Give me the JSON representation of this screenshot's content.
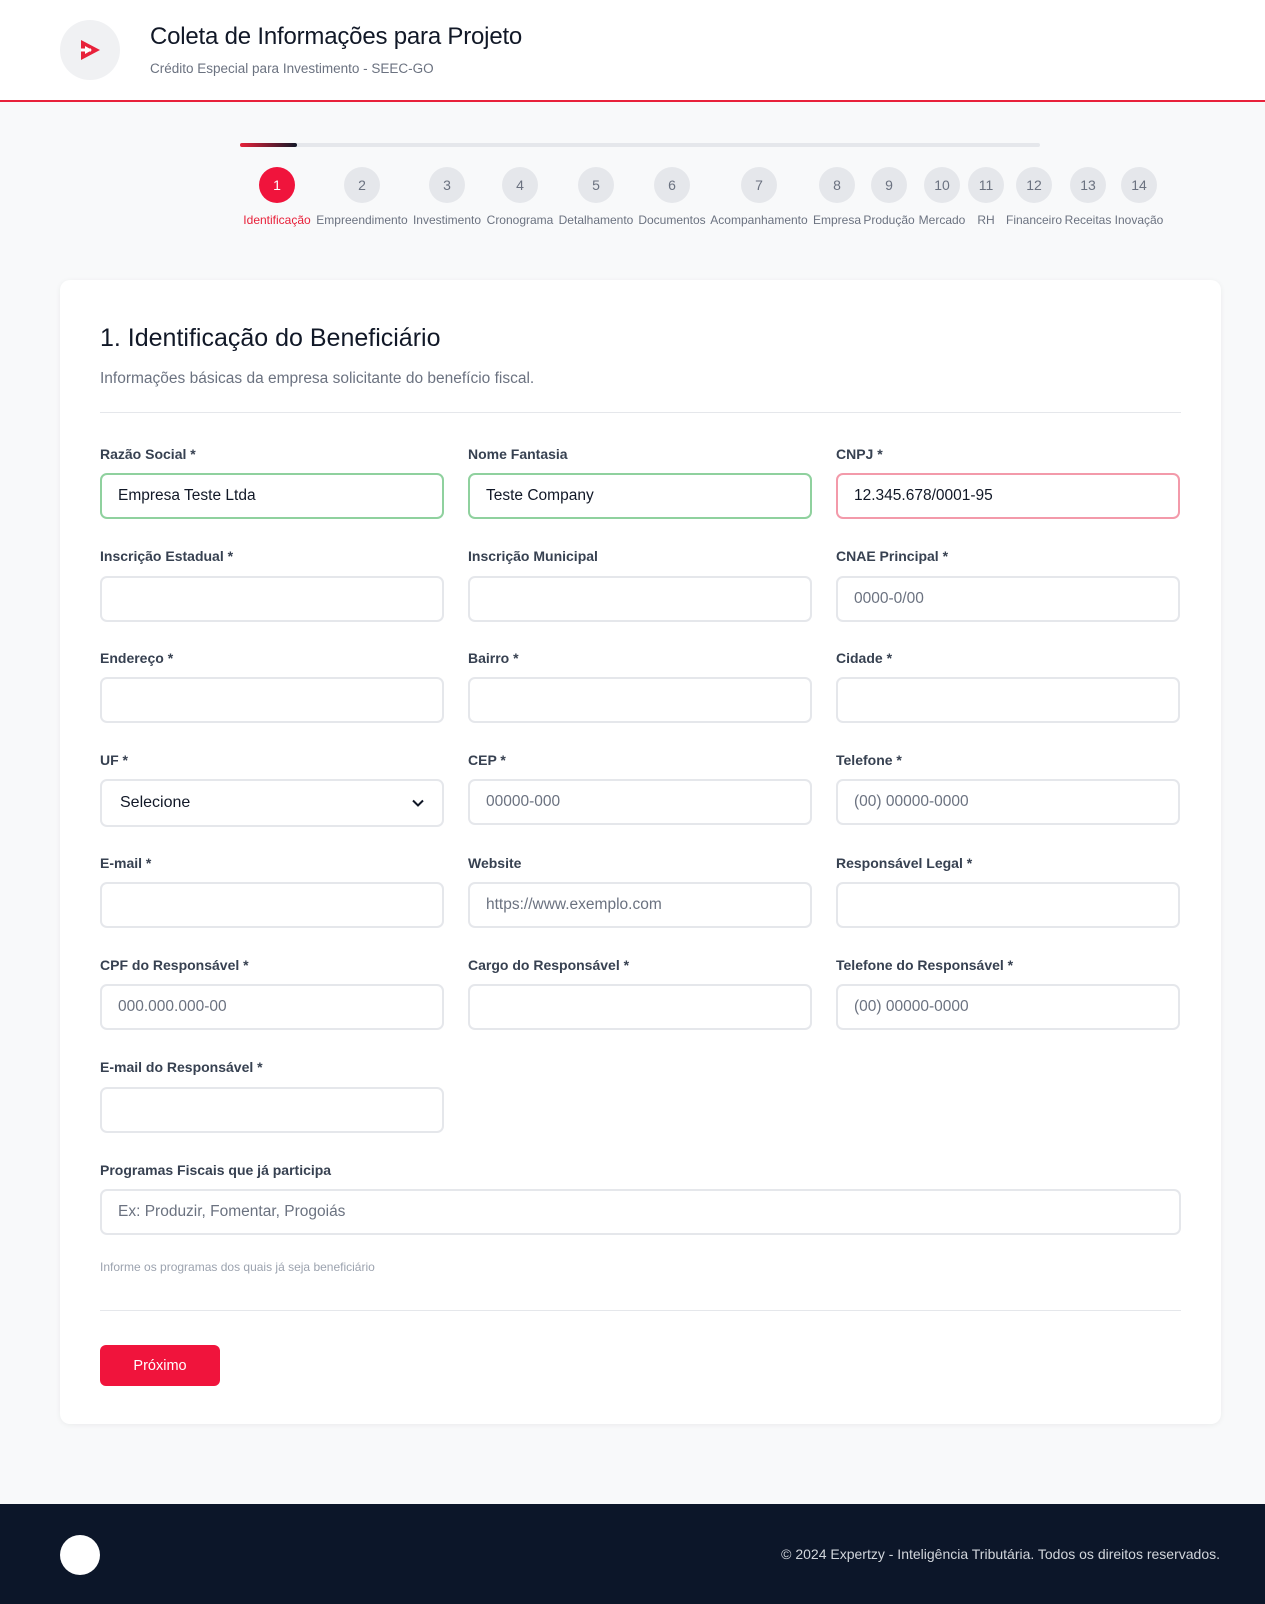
{
  "header": {
    "title": "Coleta de Informações para Projeto",
    "subtitle": "Crédito Especial para Investimento - SEEC-GO",
    "logo_icon": "play-logo-icon",
    "accent_color": "#e8213a"
  },
  "stepper": {
    "progress_fraction": 0.071,
    "steps": [
      {
        "number": "1",
        "label": "Identificação"
      },
      {
        "number": "2",
        "label": "Empreendimento"
      },
      {
        "number": "3",
        "label": "Investimento"
      },
      {
        "number": "4",
        "label": "Cronograma"
      },
      {
        "number": "5",
        "label": "Detalhamento"
      },
      {
        "number": "6",
        "label": "Documentos"
      },
      {
        "number": "7",
        "label": "Acompanhamento"
      },
      {
        "number": "8",
        "label": "Empresa"
      },
      {
        "number": "9",
        "label": "Produção"
      },
      {
        "number": "10",
        "label": "Mercado"
      },
      {
        "number": "11",
        "label": "RH"
      },
      {
        "number": "12",
        "label": "Financeiro"
      },
      {
        "number": "13",
        "label": "Receitas"
      },
      {
        "number": "14",
        "label": "Inovação"
      }
    ],
    "active_step": "1"
  },
  "section": {
    "title": "1. Identificação do Beneficiário",
    "description": "Informações básicas da empresa solicitante do benefício fiscal."
  },
  "fields": {
    "razao_social": {
      "label": "Razão Social *",
      "value": "Empresa Teste Ltda",
      "placeholder": ""
    },
    "nome_fantasia": {
      "label": "Nome Fantasia",
      "value": "Teste Company",
      "placeholder": ""
    },
    "cnpj": {
      "label": "CNPJ *",
      "value": "12.345.678/0001-95",
      "placeholder": ""
    },
    "inscricao_estadual": {
      "label": "Inscrição Estadual *",
      "value": "",
      "placeholder": ""
    },
    "inscricao_municipal": {
      "label": "Inscrição Municipal",
      "value": "",
      "placeholder": ""
    },
    "cnae": {
      "label": "CNAE Principal *",
      "value": "",
      "placeholder": "0000-0/00"
    },
    "endereco": {
      "label": "Endereço *",
      "value": "",
      "placeholder": ""
    },
    "bairro": {
      "label": "Bairro *",
      "value": "",
      "placeholder": ""
    },
    "cidade": {
      "label": "Cidade *",
      "value": "",
      "placeholder": ""
    },
    "uf": {
      "label": "UF *",
      "selected": "Selecione"
    },
    "cep": {
      "label": "CEP *",
      "value": "",
      "placeholder": "00000-000"
    },
    "telefone": {
      "label": "Telefone *",
      "value": "",
      "placeholder": "(00) 00000-0000"
    },
    "email": {
      "label": "E-mail *",
      "value": "",
      "placeholder": ""
    },
    "website": {
      "label": "Website",
      "value": "",
      "placeholder": "https://www.exemplo.com"
    },
    "responsavel_legal": {
      "label": "Responsável Legal *",
      "value": "",
      "placeholder": ""
    },
    "cpf_responsavel": {
      "label": "CPF do Responsável *",
      "value": "",
      "placeholder": "000.000.000-00"
    },
    "cargo_responsavel": {
      "label": "Cargo do Responsável *",
      "value": "",
      "placeholder": ""
    },
    "telefone_responsavel": {
      "label": "Telefone do Responsável *",
      "value": "",
      "placeholder": "(00) 00000-0000"
    },
    "email_responsavel": {
      "label": "E-mail do Responsável *",
      "value": "",
      "placeholder": ""
    },
    "programas_fiscais": {
      "label": "Programas Fiscais que já participa",
      "value": "",
      "placeholder": "Ex: Produzir, Fomentar, Progoiás",
      "hint": "Informe os programas dos quais já seja beneficiário"
    }
  },
  "actions": {
    "next_label": "Próximo"
  },
  "footer": {
    "copyright": "© 2024 Expertzy - Inteligência Tributária. Todos os direitos reservados."
  }
}
